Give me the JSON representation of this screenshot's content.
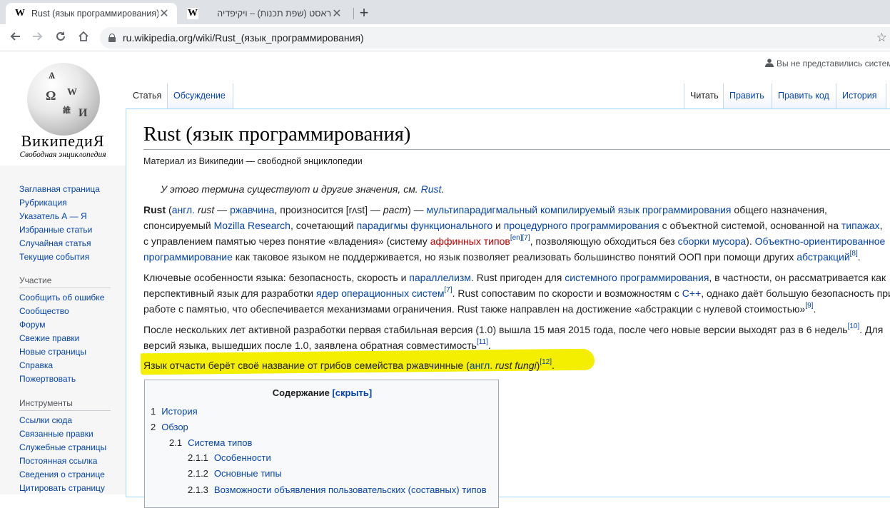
{
  "browser": {
    "tabs": [
      {
        "icon": "W",
        "title": "Rust (язык программирования)",
        "close": "✕"
      },
      {
        "icon": "W",
        "title": "ראסט (שפת תכנות) – ויקיפדיה",
        "close": "✕"
      }
    ],
    "new_tab": "+",
    "url": "ru.wikipedia.org/wiki/Rust_(язык_программирования)"
  },
  "wiki": {
    "logo": {
      "wordmark": "ВикипедиЯ",
      "tagline": "Свободная энциклопедия"
    },
    "user_tools": "Вы не представились систем",
    "namespace_tabs": [
      "Статья",
      "Обсуждение"
    ],
    "view_tabs": [
      "Читать",
      "Править",
      "Править код",
      "История"
    ],
    "sidebar": {
      "main": [
        "Заглавная страница",
        "Рубрикация",
        "Указатель А — Я",
        "Избранные статьи",
        "Случайная статья",
        "Текущие события"
      ],
      "participation_heading": "Участие",
      "participation": [
        "Сообщить об ошибке",
        "Сообщество",
        "Форум",
        "Свежие правки",
        "Новые страницы",
        "Справка",
        "Пожертвовать"
      ],
      "tools_heading": "Инструменты",
      "tools": [
        "Ссылки сюда",
        "Связанные правки",
        "Служебные страницы",
        "Постоянная ссылка",
        "Сведения о странице",
        "Цитировать страницу"
      ]
    },
    "title": "Rust (язык программирования)",
    "site_sub": "Материал из Википедии — свободной энциклопедии",
    "hatnote": {
      "text": "У этого термина существуют и другие значения, см. ",
      "link": "Rust",
      "end": "."
    },
    "p1": {
      "l1": {
        "b": "Rust",
        "t1": " (",
        "a1": "англ.",
        "t2": " ",
        "i1": "rust",
        "t3": " — ",
        "a2": "ржавчина",
        "t4": ", произносится [rʌst] — ",
        "i2": "раст",
        "t5": ") — ",
        "a3": "мультипарадигмальный",
        "t6": " ",
        "a4": "компилируемый",
        "t7": " ",
        "a5": "язык программирования",
        "t8": " общего назначения,"
      },
      "l2": {
        "t1": "спонсируемый ",
        "a1": "Mozilla Research",
        "t2": ", сочетающий ",
        "a2": "парадигмы",
        "t3": " ",
        "a3": "функционального",
        "t4": " и ",
        "a4": "процедурного программирования",
        "t5": " с объектной системой, основанной на ",
        "a5": "типажах",
        "t6": ","
      },
      "l3": {
        "t1": "с управлением памятью через понятие «владения» (систему ",
        "r1": "аффинных типов",
        "s1": "[en]",
        "s2": "[7]",
        "t2": ", позволяющую обходиться без ",
        "a1": "сборки мусора",
        "t3": "). ",
        "a2": "Объектно-ориентированное"
      },
      "l4": {
        "a1": "программирование",
        "t1": " как таковое языком не поддерживается, но язык позволяет реализовать большинство понятий ООП при помощи других ",
        "a2": "абстракций",
        "s1": "[8]",
        "t2": "."
      }
    },
    "p2": {
      "l1": {
        "t1": "Ключевые особенности языка: безопасность, скорость и ",
        "a1": "параллелизм",
        "t2": ". Rust пригоден для ",
        "a2": "системного программирования",
        "t3": ", в частности, он рассматривается как"
      },
      "l2": {
        "t1": "перспективный язык для разработки ",
        "a1": "ядер операционных систем",
        "s1": "[7]",
        "t2": ". Rust сопоставим по скорости и возможностям с ",
        "a2": "C++",
        "t3": ", однако даёт большую безопасность при"
      },
      "l3": {
        "t1": "работе с памятью, что обеспечивается механизмами ограничения. Rust также направлен на достижение «абстракции с нулевой стоимостью»",
        "s1": "[9]",
        "t2": "."
      }
    },
    "p3": {
      "l1": {
        "t1": "После нескольких лет активной разработки первая стабильная версия (1.0) вышла 15 мая 2015 года, после чего новые версии выходят раз в 6 недель",
        "s1": "[10]",
        "t2": ". Для"
      },
      "l2": {
        "t1": "версий языка, вышедших после 1.0, заявлена обратная совместимость",
        "s1": "[11]",
        "t2": "."
      }
    },
    "p4": {
      "t1": "Язык отчасти берёт своё название от грибов семейства ржавчинные (",
      "a1": "англ.",
      "t2": " ",
      "i1": "rust fungi",
      "t3": ")",
      "s1": "[12]",
      "t4": "."
    },
    "toc": {
      "title": "Содержание",
      "toggle": "[скрыть]",
      "items": [
        {
          "num": "1",
          "text": "История"
        },
        {
          "num": "2",
          "text": "Обзор"
        },
        {
          "num": "2.1",
          "text": "Система типов"
        },
        {
          "num": "2.1.1",
          "text": "Особенности"
        },
        {
          "num": "2.1.2",
          "text": "Основные типы"
        },
        {
          "num": "2.1.3",
          "text": "Возможности объявления пользовательских (составных) типов"
        }
      ]
    },
    "highlight_color": "#f4ee00",
    "link_color": "#0645ad"
  }
}
